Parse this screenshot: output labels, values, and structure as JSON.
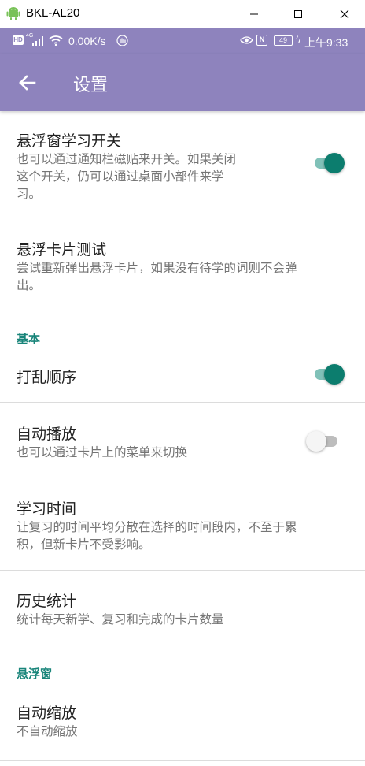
{
  "window": {
    "title": "BKL-AL20",
    "minimize_glyph": "─",
    "maximize_glyph": "☐",
    "close_glyph": "✕"
  },
  "status_bar": {
    "hd": "HD",
    "network": "4G",
    "speed": "0.00K/s",
    "nfc": "N",
    "battery": "49",
    "time": "上午9:33"
  },
  "app_bar": {
    "title": "设置"
  },
  "colors": {
    "primary": "#8e83bd",
    "accent": "#0c7d6e",
    "category": "#19857a"
  },
  "preferences": {
    "float_switch": {
      "title": "悬浮窗学习开关",
      "summary_line1": "也可以通过通知栏磁贴来开关。如果关闭",
      "summary_line2": "这个开关，仍可以通过桌面小部件来学",
      "summary_line3": "习。",
      "checked": true
    },
    "float_test": {
      "title": "悬浮卡片测试",
      "summary_line1": "尝试重新弹出悬浮卡片，如果没有待学的词则不会弹",
      "summary_line2": "出。"
    },
    "category_basic": "基本",
    "shuffle": {
      "title": "打乱顺序",
      "checked": true
    },
    "autoplay": {
      "title": "自动播放",
      "summary": "也可以通过卡片上的菜单来切换",
      "checked": false
    },
    "study_time": {
      "title": "学习时间",
      "summary_line1": "让复习的时间平均分散在选择的时间段内，不至于累",
      "summary_line2": "积，但新卡片不受影响。"
    },
    "history": {
      "title": "历史统计",
      "summary": "统计每天新学、复习和完成的卡片数量"
    },
    "category_float": "悬浮窗",
    "auto_zoom": {
      "title": "自动缩放",
      "summary": "不自动缩放"
    }
  }
}
